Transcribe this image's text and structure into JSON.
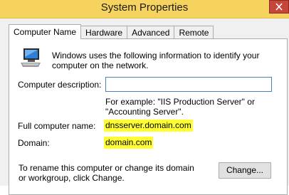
{
  "window": {
    "title": "System Properties"
  },
  "tabs": [
    {
      "label": "Computer Name",
      "active": true
    },
    {
      "label": "Hardware"
    },
    {
      "label": "Advanced"
    },
    {
      "label": "Remote"
    }
  ],
  "intro_text": "Windows uses the following information to identify your computer on the network.",
  "description": {
    "label": "Computer description:",
    "value": "",
    "example": "For example: \"IIS Production Server\" or \"Accounting Server\"."
  },
  "full_name": {
    "label": "Full computer name:",
    "value": "dnsserver.domain.com"
  },
  "domain": {
    "label": "Domain:",
    "value": "domain.com"
  },
  "rename_text": "To rename this computer or change its domain or workgroup, click Change.",
  "change_button": "Change...",
  "colors": {
    "highlight": "#ffff33",
    "titlebar": "#f6d35e",
    "close": "#c7463b"
  }
}
